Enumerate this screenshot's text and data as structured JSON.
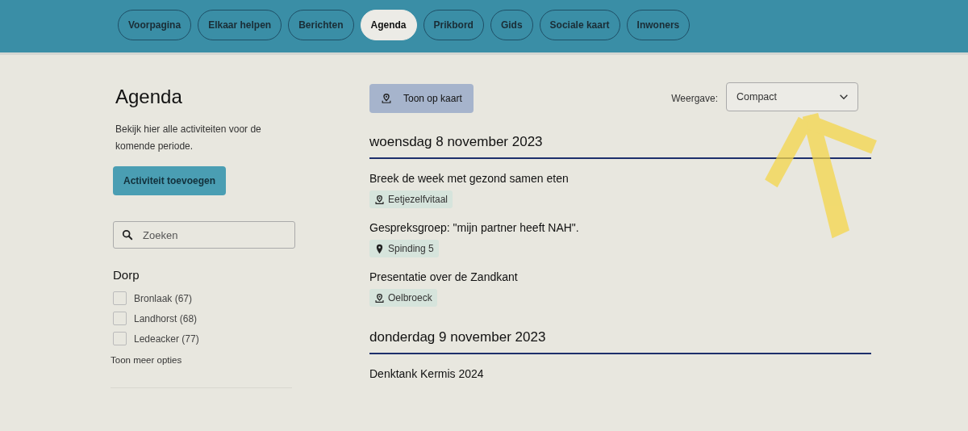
{
  "nav": {
    "tabs": [
      {
        "label": "Voorpagina",
        "selected": false
      },
      {
        "label": "Elkaar helpen",
        "selected": false
      },
      {
        "label": "Berichten",
        "selected": false
      },
      {
        "label": "Agenda",
        "selected": true
      },
      {
        "label": "Prikbord",
        "selected": false
      },
      {
        "label": "Gids",
        "selected": false
      },
      {
        "label": "Sociale kaart",
        "selected": false
      },
      {
        "label": "Inwoners",
        "selected": false
      }
    ]
  },
  "sidebar": {
    "title": "Agenda",
    "intro": "Bekijk hier alle activiteiten voor de komende periode.",
    "add_button": "Activiteit toevoegen",
    "search": {
      "placeholder": "Zoeken"
    },
    "filter": {
      "title": "Dorp",
      "options": [
        {
          "label": "Bronlaak (67)",
          "checked": false
        },
        {
          "label": "Landhorst (68)",
          "checked": false
        },
        {
          "label": "Ledeacker (77)",
          "checked": false
        }
      ],
      "more_link": "Toon meer opties"
    }
  },
  "toolbar": {
    "map_button": "Toon op kaart",
    "view_label": "Weergave:",
    "view_select": "Compact"
  },
  "days": [
    {
      "date": "woensdag 8 november 2023",
      "events": [
        {
          "title": "Breek de week met gezond samen eten",
          "location": {
            "kind": "pin-base",
            "label": "Eetjezelfvitaal"
          }
        },
        {
          "title": "Gespreksgroep: \"mijn partner heeft NAH\".",
          "location": {
            "kind": "pin",
            "label": "Spinding 5"
          }
        },
        {
          "title": "Presentatie over de Zandkant",
          "location": {
            "kind": "pin-base",
            "label": "Oelbroeck"
          }
        }
      ]
    },
    {
      "date": "donderdag 9 november 2023",
      "events": [
        {
          "title": "Denktank Kermis 2024"
        }
      ]
    }
  ],
  "annotation": {
    "kind": "arrow"
  }
}
